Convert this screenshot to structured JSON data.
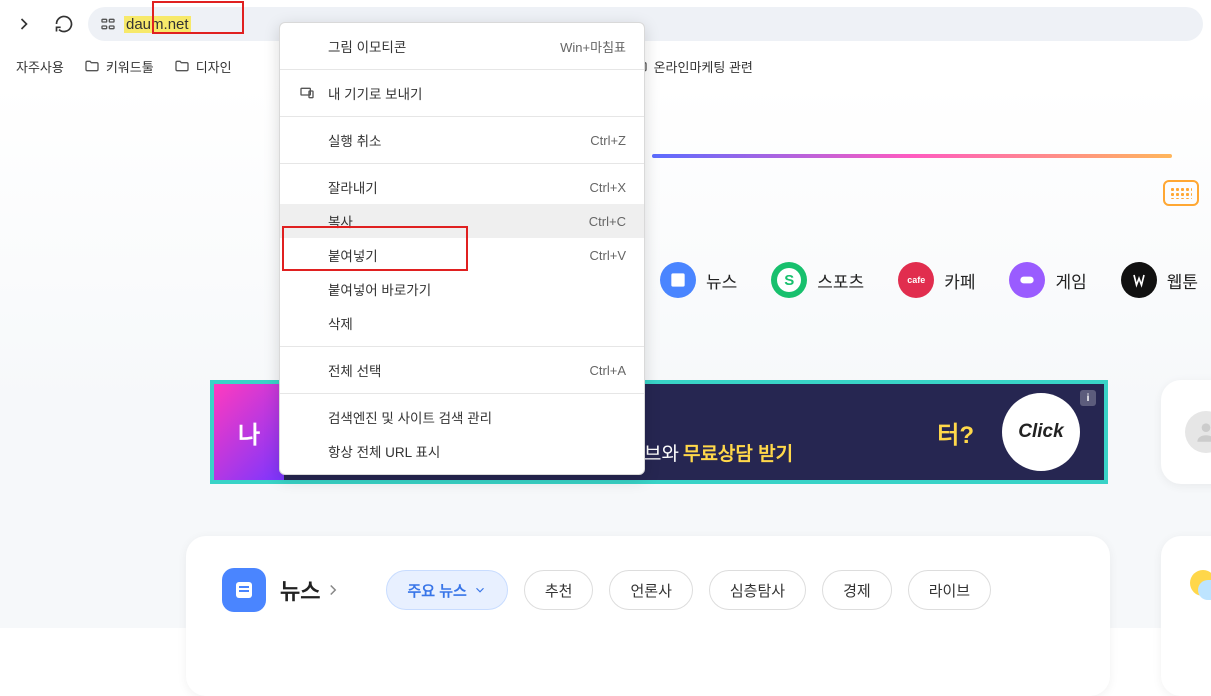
{
  "browser": {
    "url": "daum.net"
  },
  "bookmarks": {
    "frequent": "자주사용",
    "items": [
      "키워드툴",
      "디자인",
      "온라인마케팅 관련"
    ]
  },
  "context_menu": {
    "emoji": {
      "label": "그림 이모티콘",
      "shortcut": "Win+마침표"
    },
    "send_devices": {
      "label": "내 기기로 보내기"
    },
    "undo": {
      "label": "실행 취소",
      "shortcut": "Ctrl+Z"
    },
    "cut": {
      "label": "잘라내기",
      "shortcut": "Ctrl+X"
    },
    "copy": {
      "label": "복사",
      "shortcut": "Ctrl+C"
    },
    "paste": {
      "label": "붙여넣기",
      "shortcut": "Ctrl+V"
    },
    "paste_go": {
      "label": "붙여넣어 바로가기"
    },
    "delete": {
      "label": "삭제"
    },
    "select_all": {
      "label": "전체 선택",
      "shortcut": "Ctrl+A"
    },
    "search_mgmt": {
      "label": "검색엔진 및 사이트 검색 관리"
    },
    "always_full_url": {
      "label": "항상 전체 URL 표시"
    }
  },
  "services": {
    "news": "뉴스",
    "sports": "스포츠",
    "cafe": "카페",
    "game": "게임",
    "webtoon": "웹툰"
  },
  "ad": {
    "left": "나",
    "q": "터?",
    "line": "브와 ",
    "bold": "무료상담 받기",
    "click": "Click",
    "info": "i"
  },
  "news_section": {
    "title": "뉴스",
    "tabs": {
      "main": "주요 뉴스",
      "rec": "추천",
      "press": "언론사",
      "deep": "심층탐사",
      "econ": "경제",
      "live": "라이브"
    }
  }
}
